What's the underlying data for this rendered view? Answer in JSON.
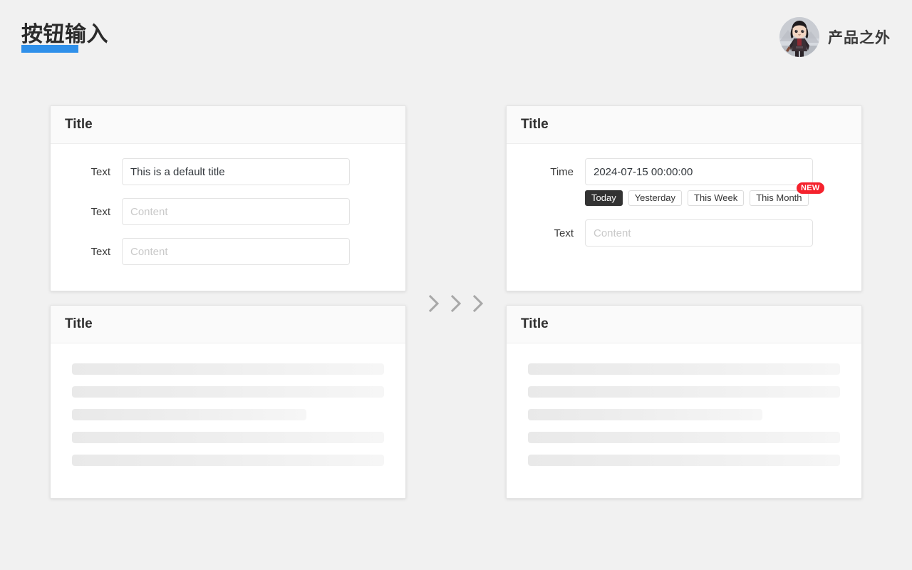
{
  "header": {
    "title": "按钮输入",
    "underline_color": "#2f90ea",
    "brand_name": "产品之外",
    "avatar_icon": "chibi-character-avatar"
  },
  "page": {
    "background_color": "#f1f1f1",
    "transition_icon": "chevron-right-icon"
  },
  "cards": {
    "top_left": {
      "title": "Title",
      "rows": [
        {
          "label": "Text",
          "value": "This is a default title",
          "placeholder": ""
        },
        {
          "label": "Text",
          "value": "",
          "placeholder": "Content"
        },
        {
          "label": "Text",
          "value": "",
          "placeholder": "Content"
        }
      ]
    },
    "top_right": {
      "title": "Title",
      "time_label": "Time",
      "time_value": "2024-07-15 00:00:00",
      "quick_ranges": [
        {
          "label": "Today",
          "active": true,
          "badge": ""
        },
        {
          "label": "Yesterday",
          "active": false,
          "badge": ""
        },
        {
          "label": "This Week",
          "active": false,
          "badge": ""
        },
        {
          "label": "This Month",
          "active": false,
          "badge": "NEW"
        }
      ],
      "badge_color": "#f5222d",
      "active_button_color": "#333333",
      "text_label": "Text",
      "text_value": "",
      "text_placeholder": "Content"
    },
    "bottom_left": {
      "title": "Title",
      "skeleton_widths": [
        "100%",
        "100%",
        "75%",
        "100%",
        "100%"
      ]
    },
    "bottom_right": {
      "title": "Title",
      "skeleton_widths": [
        "100%",
        "100%",
        "75%",
        "100%",
        "100%"
      ]
    }
  }
}
